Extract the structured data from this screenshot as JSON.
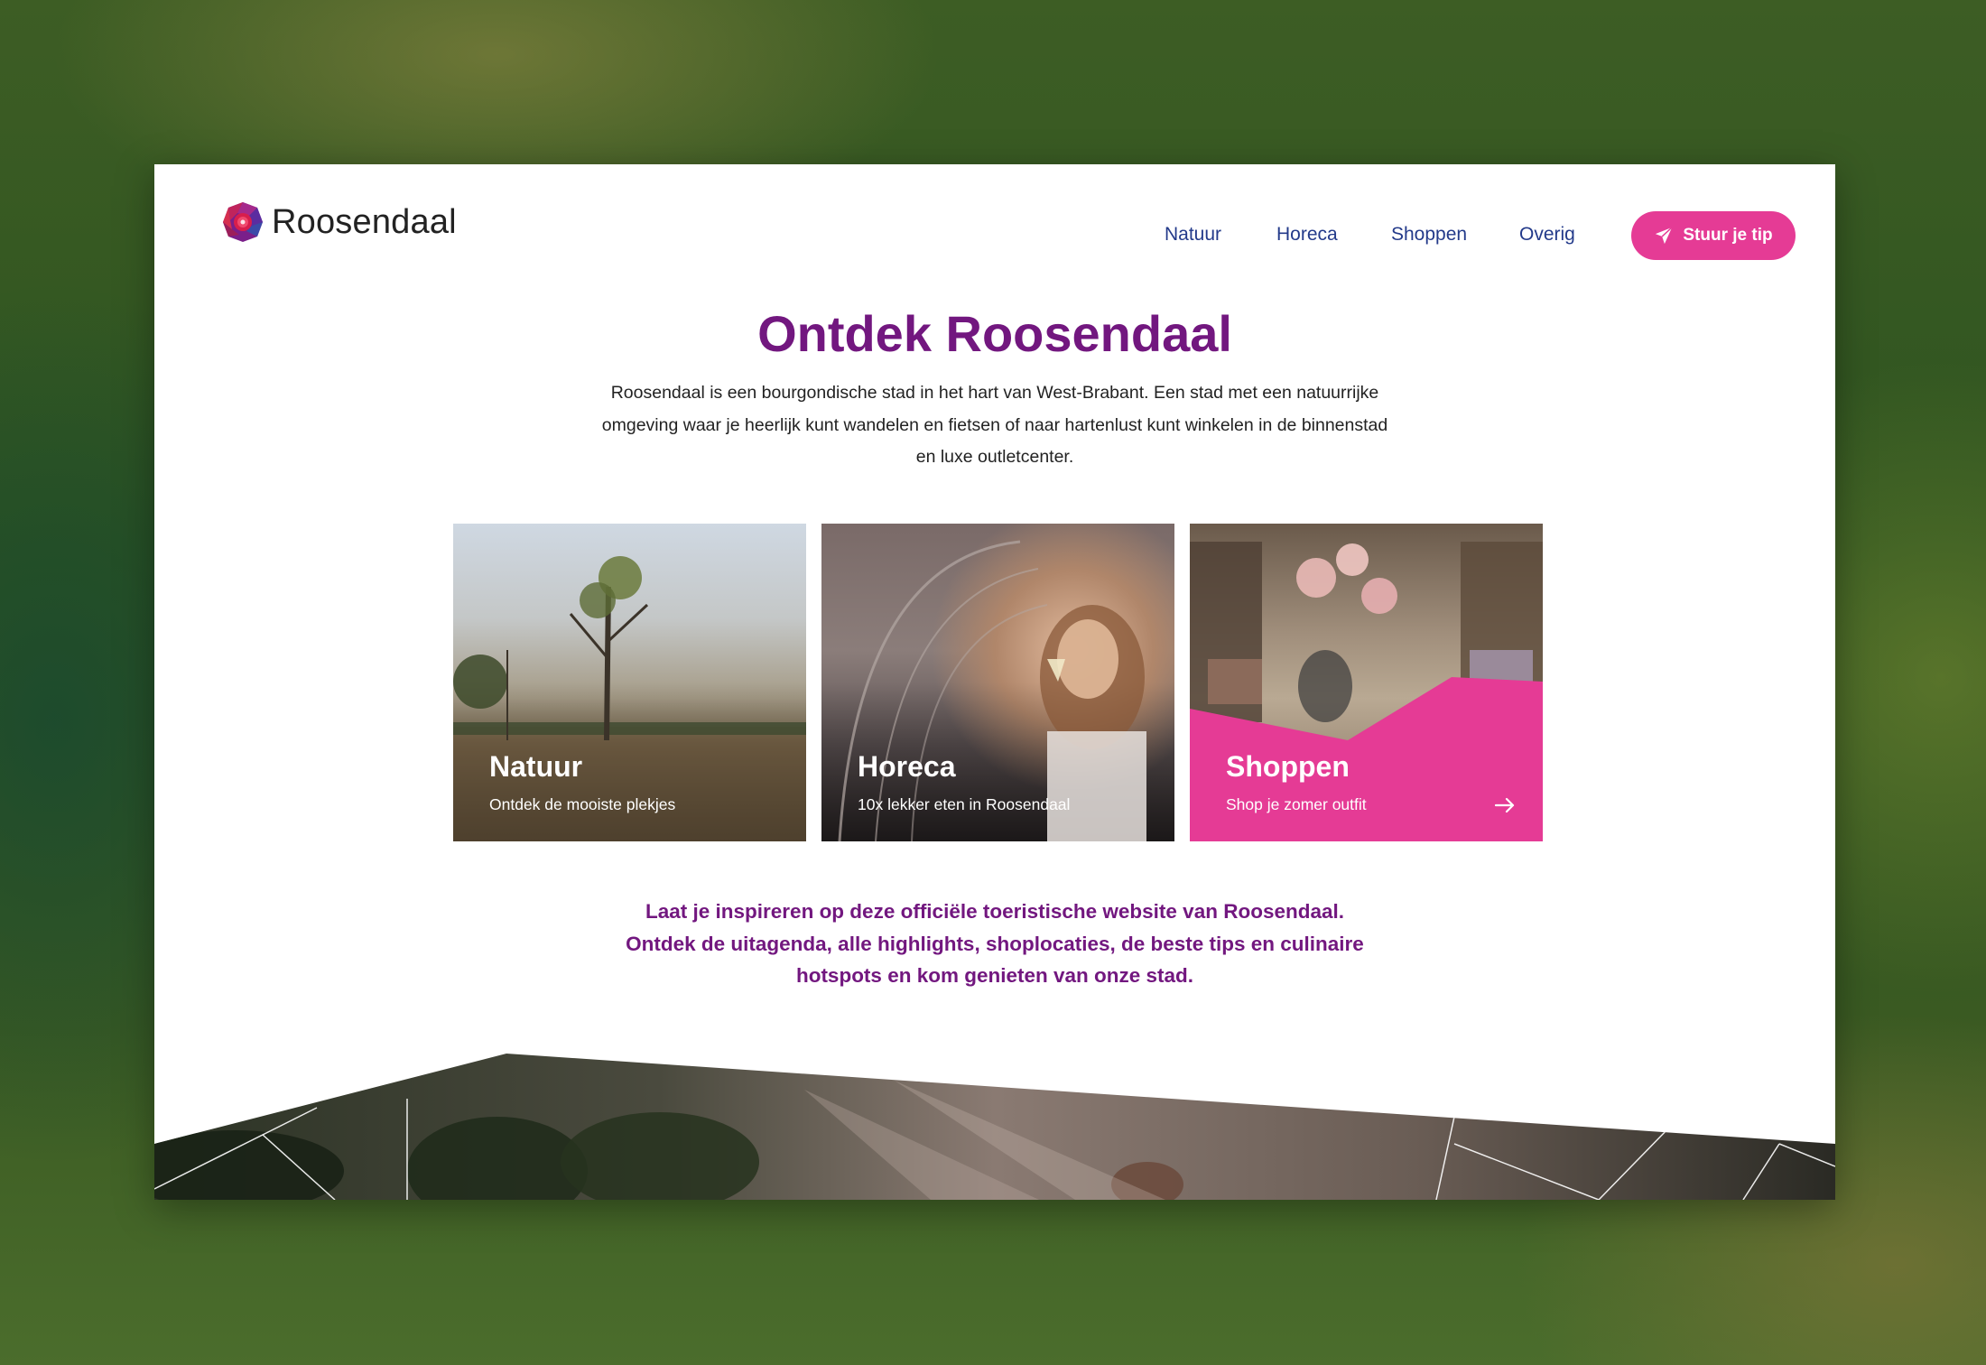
{
  "brand": {
    "name": "Roosendaal",
    "logo_icon": "rose-logo-icon"
  },
  "nav": {
    "items": [
      {
        "label": "Natuur"
      },
      {
        "label": "Horeca"
      },
      {
        "label": "Shoppen"
      },
      {
        "label": "Overig"
      }
    ],
    "tip_button": {
      "label": "Stuur je tip",
      "icon": "send-icon"
    }
  },
  "main": {
    "title": "Ontdek Roosendaal",
    "intro": "Roosendaal is een bourgondische stad in het hart van West-Brabant. Een stad met een natuurrijke omgeving waar je heerlijk kunt wandelen en fietsen of naar hartenlust kunt winkelen in de binnenstad en luxe outletcenter.",
    "cards": [
      {
        "title": "Natuur",
        "subtitle": "Ontdek de mooiste plekjes"
      },
      {
        "title": "Horeca",
        "subtitle": "10x lekker eten in Roosendaal"
      },
      {
        "title": "Shoppen",
        "subtitle": "Shop je zomer outfit",
        "icon": "arrow-right-icon"
      }
    ],
    "tagline": "Laat je inspireren op deze officiële toeristische website van Roosendaal. Ontdek de uitagenda, alle highlights, shoplocaties, de beste tips en culinaire hotspots en kom genieten van onze stad."
  },
  "colors": {
    "brand_purple": "#72177f",
    "accent_pink": "#e53b95",
    "nav_blue": "#233a8a"
  }
}
